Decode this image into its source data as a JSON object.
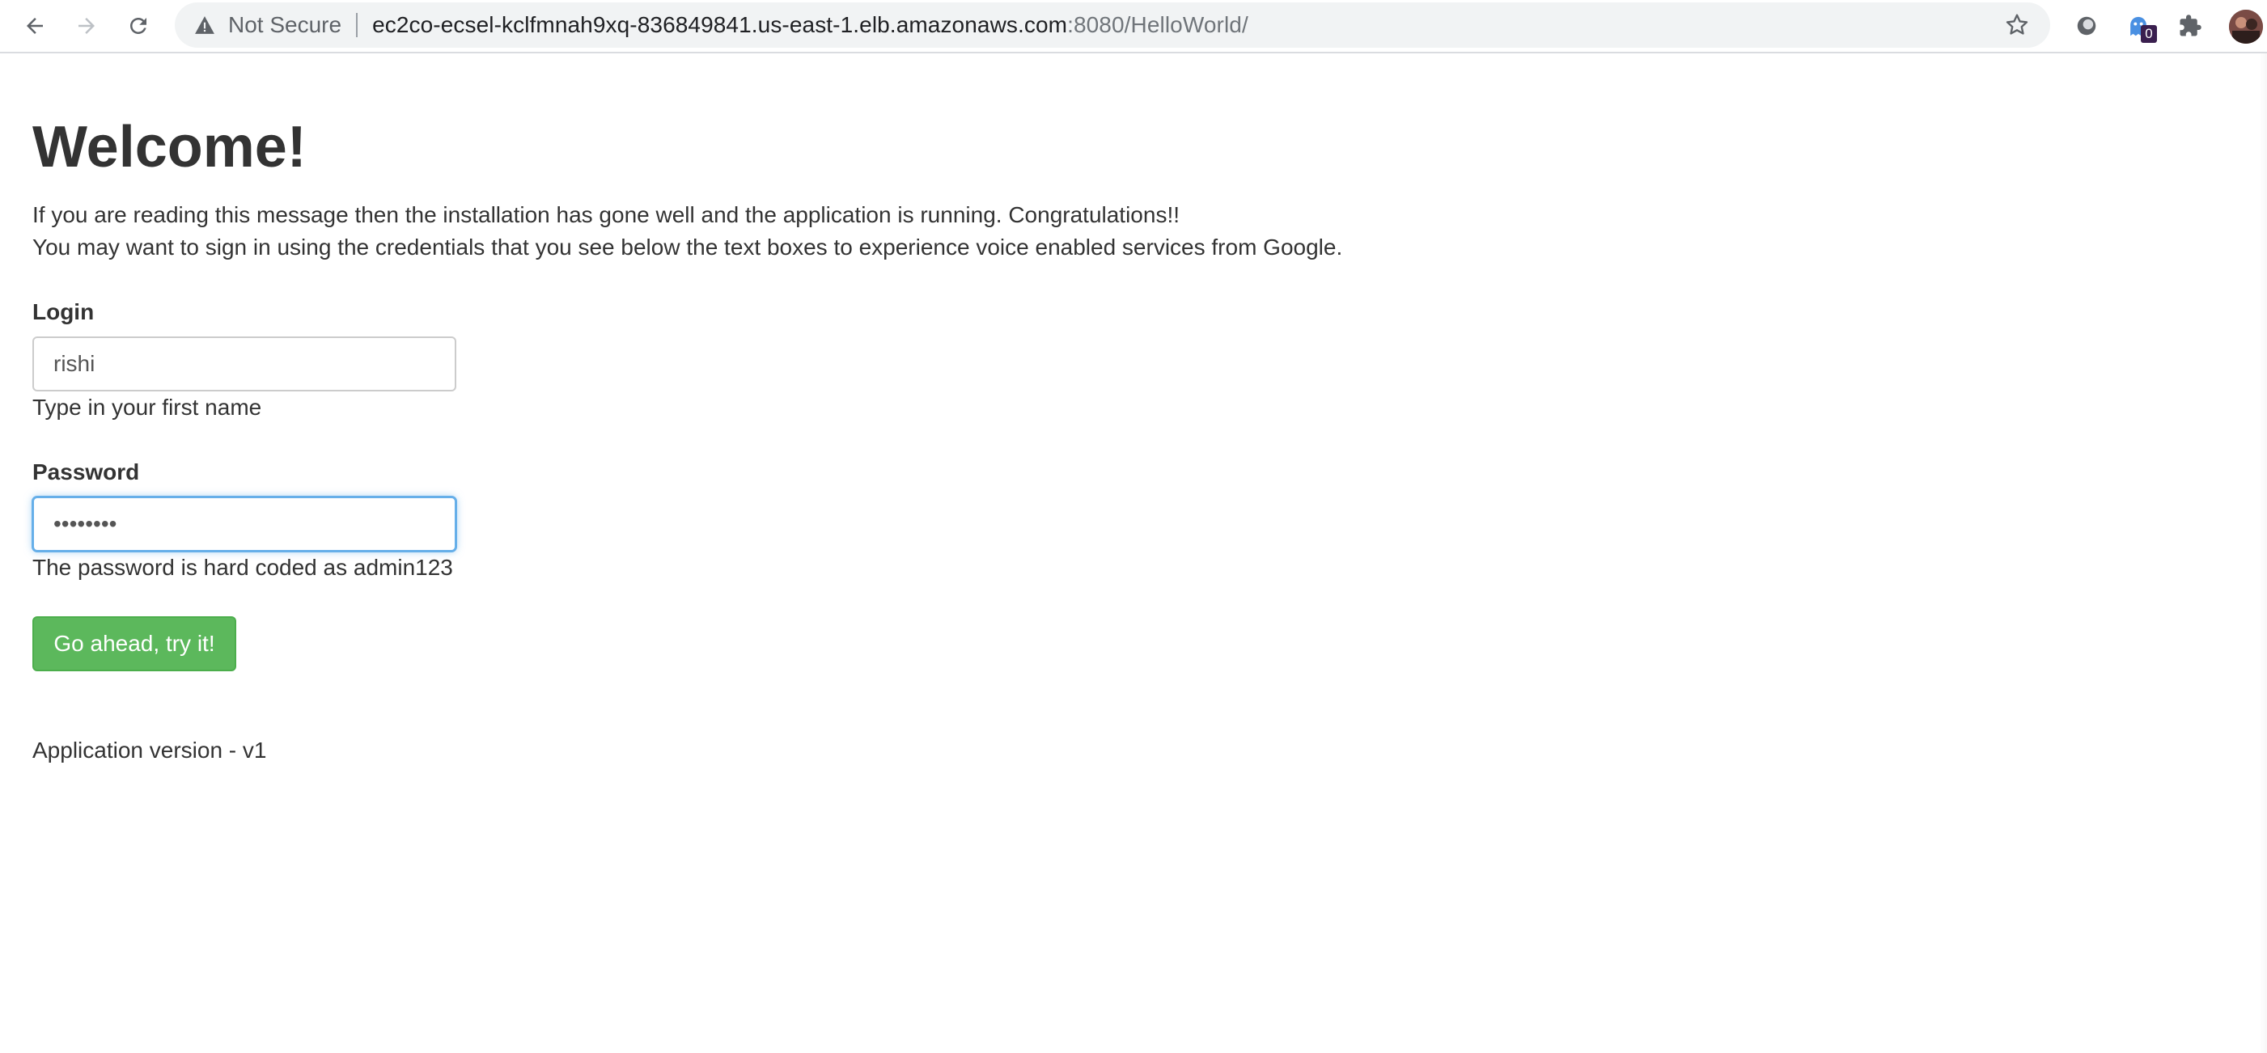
{
  "browser": {
    "security_label": "Not Secure",
    "url_host": "ec2co-ecsel-kclfmnah9xq-836849841.us-east-1.elb.amazonaws.com",
    "url_rest": ":8080/HelloWorld/",
    "extension_badge": "0",
    "icons": {
      "back": "back-arrow-icon",
      "forward": "forward-arrow-icon",
      "reload": "reload-icon",
      "warning": "warning-icon",
      "bookmark": "star-icon",
      "extensions": "puzzle-icon"
    }
  },
  "page": {
    "title": "Welcome!",
    "intro_line1": "If you are reading this message then the installation has gone well and the application is running. Congratulations!!",
    "intro_line2": "You may want to sign in using the credentials that you see below the text boxes to experience voice enabled services from Google.",
    "login": {
      "label": "Login",
      "value": "rishi",
      "help": "Type in your first name"
    },
    "password": {
      "label": "Password",
      "value": "••••••••",
      "help": "The password is hard coded as admin123"
    },
    "submit_label": "Go ahead, try it!",
    "version": "Application version - v1"
  },
  "colors": {
    "button_green": "#5cb85c",
    "focus_blue": "#66afe9",
    "text": "#333333"
  }
}
